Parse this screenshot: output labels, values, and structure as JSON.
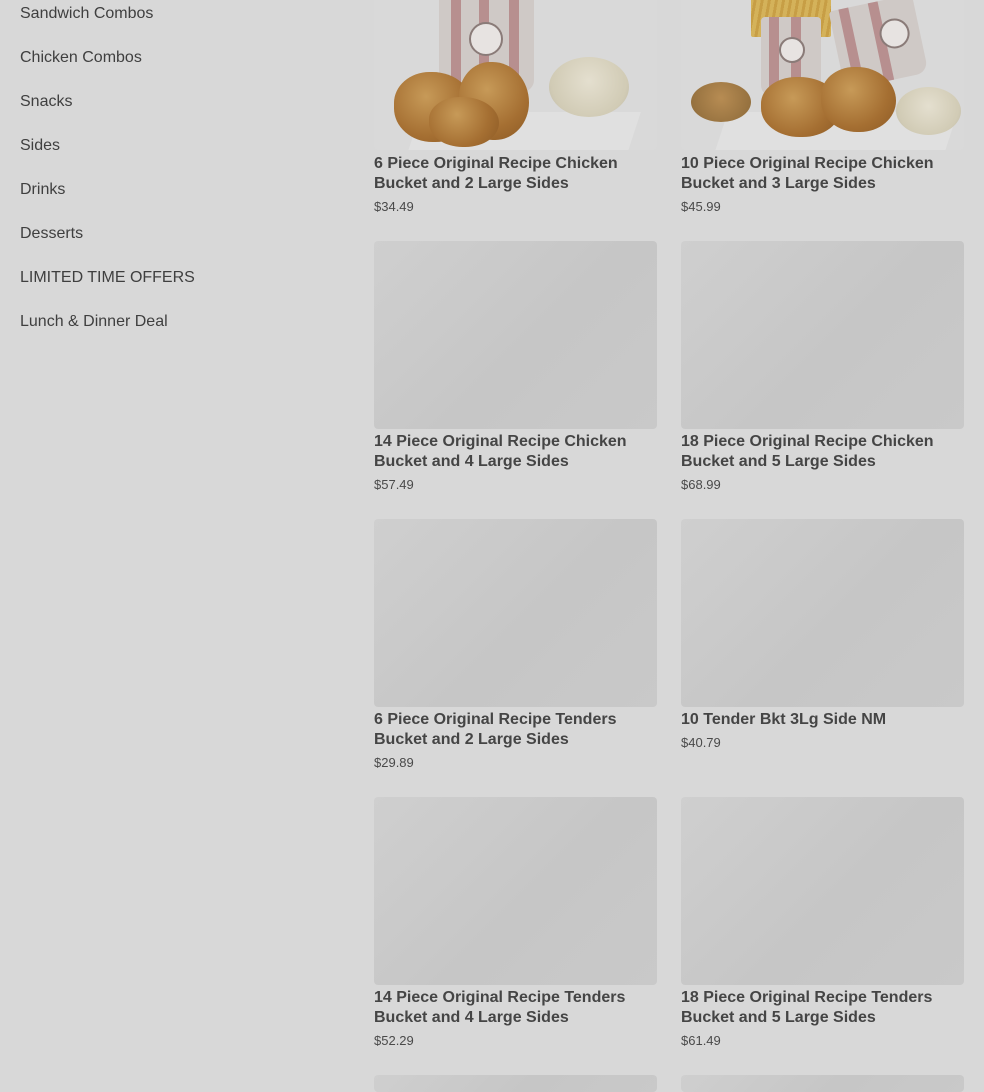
{
  "sidebar": {
    "items": [
      {
        "label": "Sandwich Combos"
      },
      {
        "label": "Chicken Combos"
      },
      {
        "label": "Snacks"
      },
      {
        "label": "Sides"
      },
      {
        "label": "Drinks"
      },
      {
        "label": "Desserts"
      },
      {
        "label": "LIMITED TIME OFFERS"
      },
      {
        "label": "Lunch & Dinner Deal"
      }
    ]
  },
  "products": [
    {
      "title": "6 Piece Original Recipe Chicken Bucket and 2 Large Sides",
      "price": "$34.49"
    },
    {
      "title": "10 Piece Original Recipe Chicken Bucket and 3 Large Sides",
      "price": "$45.99"
    },
    {
      "title": "14 Piece Original Recipe Chicken Bucket and 4 Large Sides",
      "price": "$57.49"
    },
    {
      "title": "18 Piece Original Recipe Chicken Bucket and 5 Large Sides",
      "price": "$68.99"
    },
    {
      "title": "6 Piece Original Recipe Tenders Bucket and 2 Large Sides",
      "price": "$29.89"
    },
    {
      "title": "10 Tender Bkt 3Lg Side NM",
      "price": "$40.79"
    },
    {
      "title": "14 Piece Original Recipe Tenders Bucket and 4 Large Sides",
      "price": "$52.29"
    },
    {
      "title": "18 Piece Original Recipe Tenders Bucket and 5 Large Sides",
      "price": "$61.49"
    }
  ]
}
